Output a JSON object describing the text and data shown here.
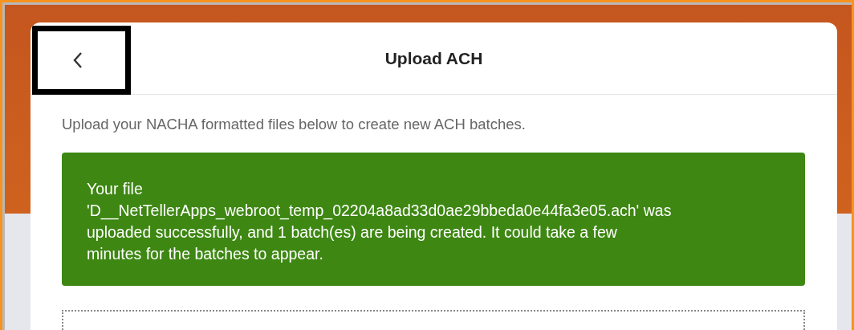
{
  "dialog": {
    "title": "Upload ACH"
  },
  "description": "Upload your NACHA formatted files below to create new ACH batches.",
  "alert": {
    "kind": "success",
    "message": "Your file 'D__NetTellerApps_webroot_temp_02204a8ad33d0ae29bbeda0e44fa3e05.ach' was uploaded successfully, and 1 batch(es) are being created. It could take a few minutes for the batches to appear."
  }
}
